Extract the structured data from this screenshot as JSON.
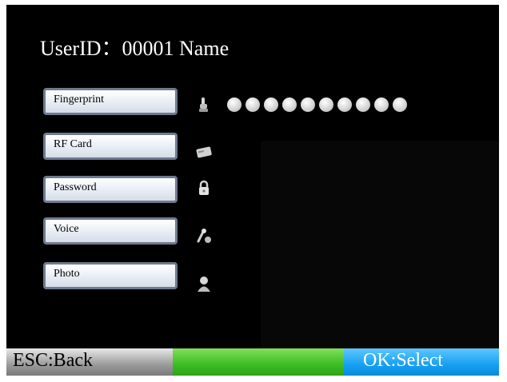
{
  "header": {
    "title": "UserID：00001 Name"
  },
  "menu": {
    "items": [
      {
        "label": "Fingerprint",
        "icon": "fingerprint-icon"
      },
      {
        "label": "RF Card",
        "icon": "rf-card-icon"
      },
      {
        "label": "Password",
        "icon": "lock-icon"
      },
      {
        "label": "Voice",
        "icon": "microphone-icon"
      },
      {
        "label": "Photo",
        "icon": "user-photo-icon"
      }
    ]
  },
  "fingerprint_slots": {
    "count": 10
  },
  "softkeys": {
    "left": "ESC:Back",
    "right": "OK:Select"
  },
  "colors": {
    "screen_background": "#000000",
    "esc_bar": "#9a9a9a",
    "middle_bar": "#3cbc24",
    "ok_bar": "#16a0f2"
  }
}
